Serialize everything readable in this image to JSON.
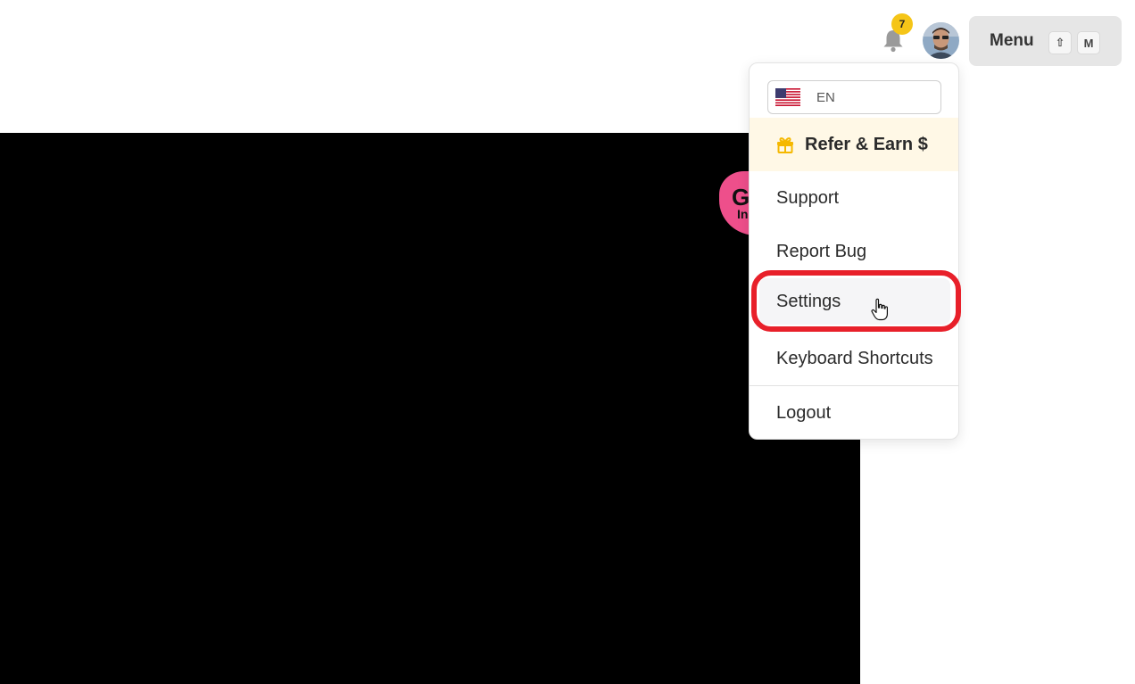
{
  "header": {
    "notification_count": "7",
    "menu_label": "Menu",
    "shortcut_keys": [
      "⇧",
      "M"
    ]
  },
  "dropdown": {
    "language": "EN",
    "items": [
      {
        "label": "Refer & Earn $",
        "icon": "gift-icon"
      },
      {
        "label": "Support"
      },
      {
        "label": "Report Bug"
      },
      {
        "label": "Settings"
      },
      {
        "label": "Keyboard Shortcuts"
      },
      {
        "label": "Logout"
      }
    ]
  },
  "video_logo": {
    "text_large": "G",
    "text_small": "In"
  },
  "colors": {
    "badge": "#f5c518",
    "highlight": "#e8202a",
    "refer_bg": "#fff8e6",
    "gift": "#f5b800"
  }
}
